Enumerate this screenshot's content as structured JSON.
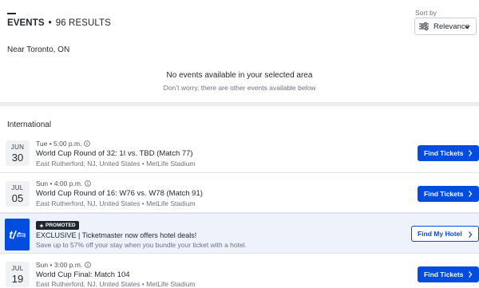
{
  "header": {
    "title": "EVENTS",
    "results": "96 RESULTS",
    "sort_label": "Sort by",
    "sort_value": "Relevance"
  },
  "location": "Near Toronto, ON",
  "empty_state": {
    "title": "No events available in your selected area",
    "subtitle": "Don’t worry, there are other events available below"
  },
  "section_title": "International",
  "events": [
    {
      "month": "JUN",
      "day": "30",
      "meta": "Tue • 5:00 p.m.",
      "title": "World Cup Round of 32: 1I vs. TBD (Match 77)",
      "venue": "East Rutherford, NJ, United States • MetLife Stadium",
      "button": "Find Tickets"
    },
    {
      "month": "JUL",
      "day": "05",
      "meta": "Sun • 4:00 p.m.",
      "title": "World Cup Round of 16: W76 vs. W78 (Match 91)",
      "venue": "East Rutherford, NJ, United States • MetLife Stadium",
      "button": "Find Tickets"
    },
    {
      "month": "JUL",
      "day": "19",
      "meta": "Sun • 3:00 p.m.",
      "title": "World Cup Final: Match 104",
      "venue": "East Rutherford, NJ, United States • MetLife Stadium",
      "button": "Find Tickets"
    }
  ],
  "promo": {
    "badge": "PROMOTED",
    "logo_text": "t/",
    "title": "EXCLUSIVE | Ticketmaster now offers hotel deals!",
    "subtitle": "Save up to 57% off your stay when you bundle your ticket with a hotel.",
    "button": "Find My Hotel"
  },
  "colors": {
    "brand_blue": "#024ddf",
    "promo_bg": "#eef2fb",
    "divider": "#dfe2e6"
  },
  "icons": [
    "sliders-icon",
    "chevron-down-icon",
    "info-icon",
    "chevron-right-icon",
    "bed-icon",
    "sparkle-icon"
  ]
}
